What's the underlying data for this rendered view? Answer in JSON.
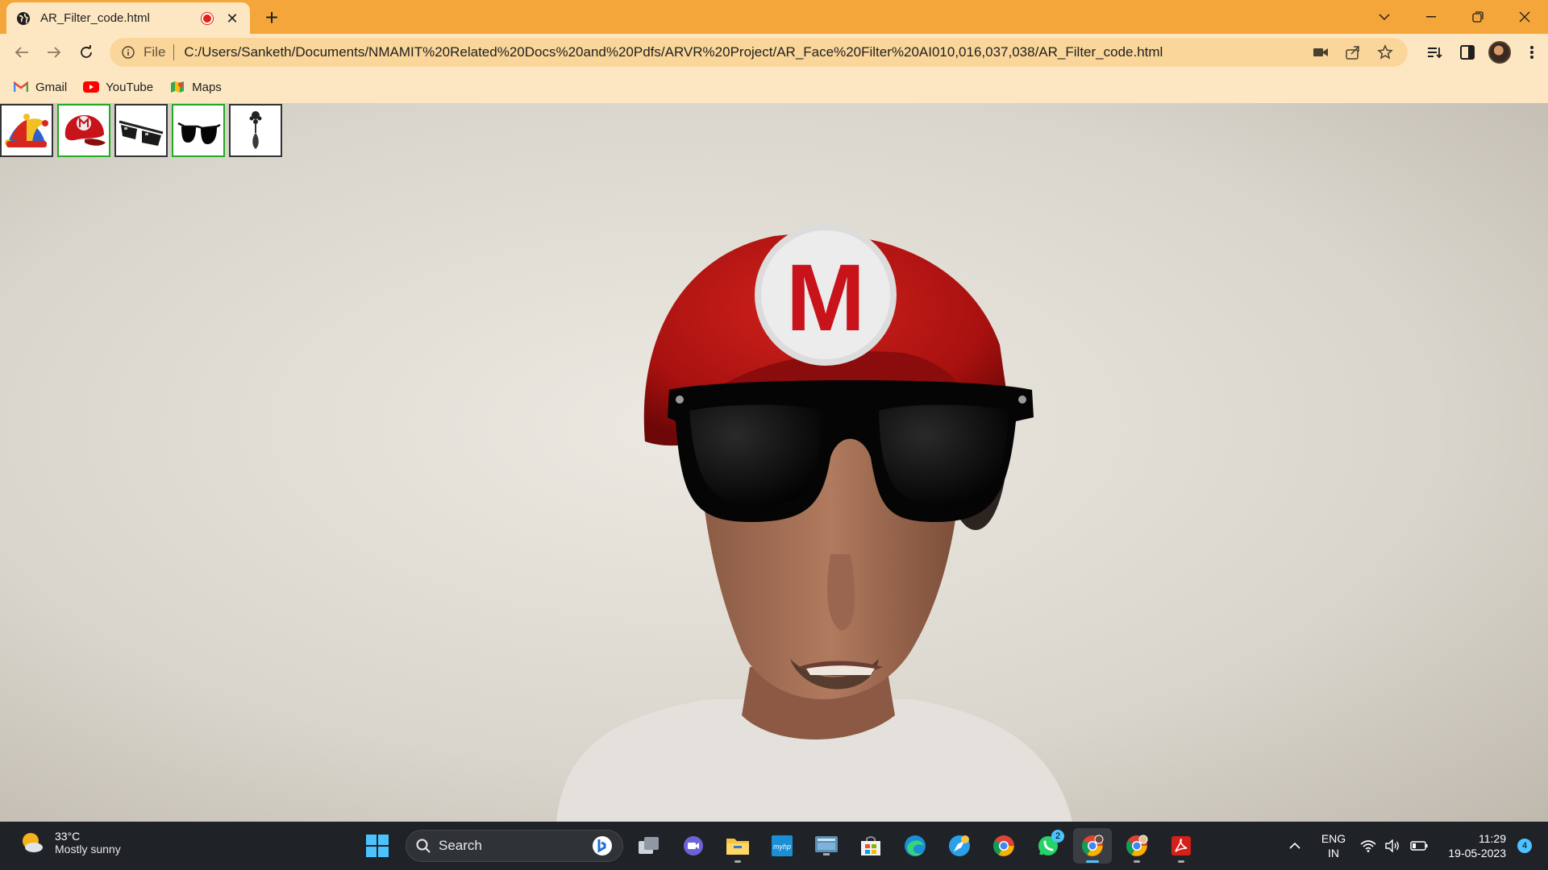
{
  "browser": {
    "tab": {
      "title": "AR_Filter_code.html",
      "favicon": "globe-icon",
      "recording": true
    },
    "new_tab_label": "+",
    "address_bar": {
      "scheme_label": "File",
      "url": "C:/Users/Sanketh/Documents/NMAMIT%20Related%20Docs%20and%20Pdfs/ARVR%20Project/AR_Face%20Filter%20AI010,016,037,038/AR_Filter_code.html"
    },
    "bookmarks": [
      {
        "label": "Gmail",
        "icon": "gmail-icon"
      },
      {
        "label": "YouTube",
        "icon": "youtube-icon"
      },
      {
        "label": "Maps",
        "icon": "maps-icon"
      }
    ],
    "accent_color": "#f5a63a",
    "toolbar_color": "#fde7c2"
  },
  "page": {
    "filters": [
      {
        "name": "jester-hat",
        "selected": false
      },
      {
        "name": "mario-cap",
        "selected": true
      },
      {
        "name": "pixel-glasses",
        "selected": false
      },
      {
        "name": "sunglasses",
        "selected": true
      },
      {
        "name": "earring",
        "selected": false
      }
    ],
    "cap_letter": "M"
  },
  "taskbar": {
    "weather": {
      "temp": "33°C",
      "condition": "Mostly sunny"
    },
    "search_label": "Search",
    "whatsapp_badge": "2",
    "language": {
      "line1": "ENG",
      "line2": "IN"
    },
    "clock": {
      "time": "11:29",
      "date": "19-05-2023"
    },
    "notification_count": "4"
  }
}
